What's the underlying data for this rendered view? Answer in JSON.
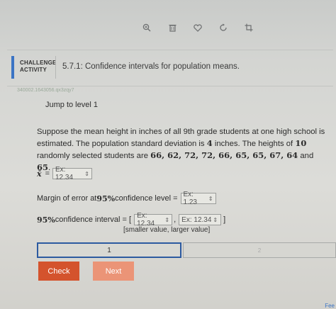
{
  "toolbar": {
    "icons": [
      {
        "name": "zoom-in-icon",
        "glyph": "⊕"
      },
      {
        "name": "trash-icon",
        "glyph": "🗑"
      },
      {
        "name": "heart-icon",
        "glyph": "♡"
      },
      {
        "name": "refresh-icon",
        "glyph": "↻"
      },
      {
        "name": "crop-icon",
        "glyph": "⌗"
      }
    ]
  },
  "header": {
    "label_line1": "CHALLENGE",
    "label_line2": "ACTIVITY",
    "title": "5.7.1: Confidence intervals for population means."
  },
  "activity_id": "340002.1643056.qx3zqy7",
  "jump_label": "Jump to level 1",
  "problem": {
    "p1": "Suppose the mean height in inches of all 9th grade students at one high school is estimated. The population standard deviation is ",
    "sd": "4",
    "p2": " inches. The heights of ",
    "n": "10",
    "p3": " randomly selected students are ",
    "values": "66, 62, 72, 72, 66, 65, 65, 67, 64",
    "p4": " and ",
    "last": "65",
    "p5": "."
  },
  "xbar_row": {
    "symbol": "x̄",
    "equals": "=",
    "placeholder": "Ex: 12.34"
  },
  "margin_row": {
    "pre": "Margin of error at ",
    "pct": "95%",
    "post": " confidence level = ",
    "placeholder": "Ex: 1.23"
  },
  "ci_row": {
    "pct": "95%",
    "post": " confidence interval = [",
    "placeholder1": "Ex: 12.34",
    "comma": ",",
    "placeholder2": "Ex: 12.34",
    "close": "]"
  },
  "hint": "[smaller value, larger value]",
  "progress": {
    "level1": "1",
    "level2": "2"
  },
  "buttons": {
    "check": "Check",
    "next": "Next"
  },
  "corner_text": "Fee",
  "colors": {
    "accent": "#3b74c4",
    "check": "#d4532d",
    "next": "#eb9477",
    "progress_border": "#2c5aa0"
  }
}
